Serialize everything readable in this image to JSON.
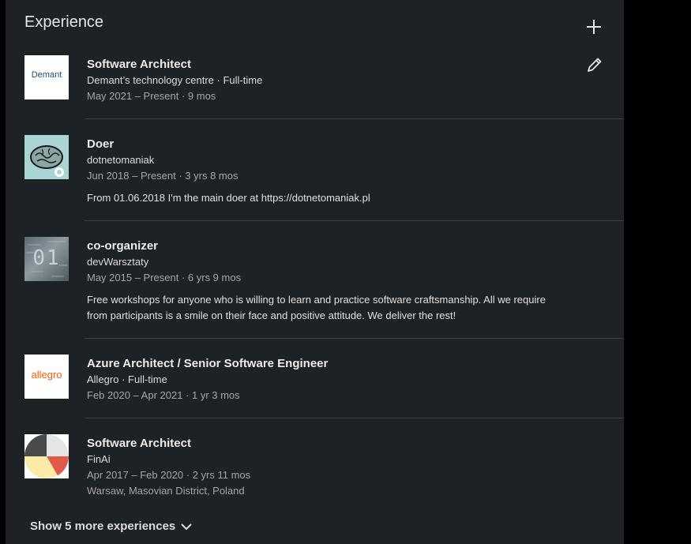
{
  "section": {
    "title": "Experience"
  },
  "entries": [
    {
      "title": "Software Architect",
      "company": "Demant’s technology centre · Full-time",
      "dates": "May 2021 – Present · 9 mos",
      "logo_text": "Demant"
    },
    {
      "title": "Doer",
      "company": "dotnetomaniak",
      "dates": "Jun 2018 – Present · 3 yrs 8 mos",
      "description": "From 01.06.2018 I'm the main doer at https://dotnetomaniak.pl"
    },
    {
      "title": "co-organizer",
      "company": "devWarsztaty",
      "dates": "May 2015 – Present · 6 yrs 9 mos",
      "description": "Free workshops for anyone who is willing to learn and practice software craftsmanship. All we require from participants is a smile on their face and positive attitude. We deliver the rest!",
      "logo_text": "01"
    },
    {
      "title": "Azure Architect / Senior Software Engineer",
      "company": "Allegro · Full-time",
      "dates": "Feb 2020 – Apr 2021 · 1 yr 3 mos",
      "logo_text": "allegro"
    },
    {
      "title": "Software Architect",
      "company": "FinAi",
      "dates": "Apr 2017 – Feb 2020 · 2 yrs 11 mos",
      "location": "Warsaw, Masovian District, Poland"
    }
  ],
  "footer": {
    "show_more": "Show 5 more experiences"
  },
  "icons": {
    "add": "plus-icon",
    "edit": "pencil-icon",
    "show_more": "chevron-down-icon"
  },
  "colors": {
    "panel_bg": "#1d2226",
    "allegro_orange": "#ff5a00",
    "demant_blue": "#1c4f82"
  }
}
